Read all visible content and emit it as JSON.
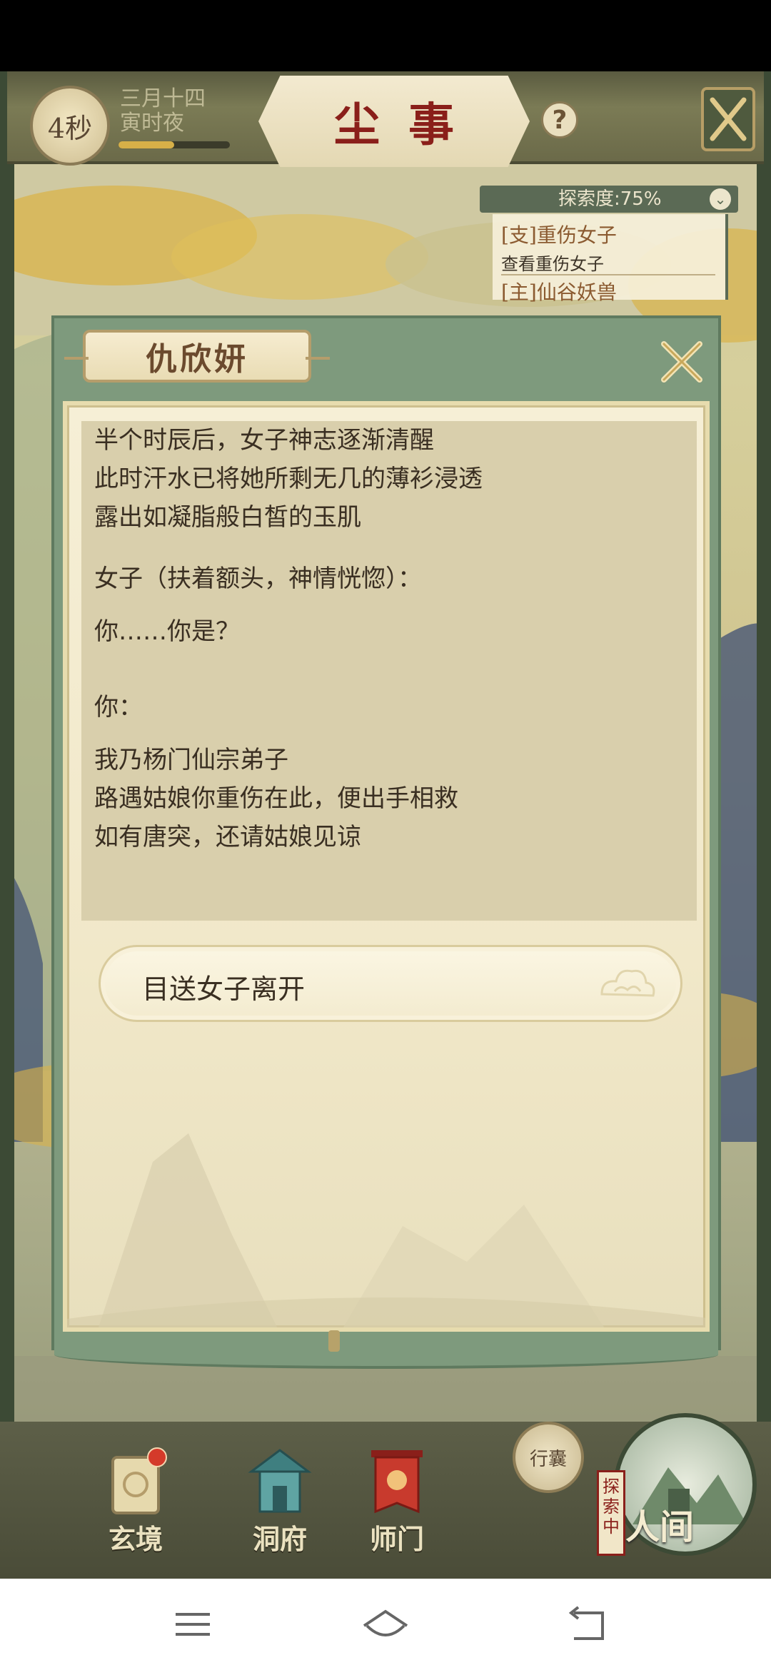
{
  "header": {
    "timer": "4秒",
    "date": "三月十四",
    "time_of_day": "寅时夜",
    "title": "尘事",
    "help": "?",
    "time_progress": 0.5
  },
  "explore": {
    "progress_label": "探索度:75%",
    "quests": [
      {
        "title": "[支]重伤女子",
        "subtitle": "查看重伤女子"
      },
      {
        "title": "[主]仙谷妖兽"
      }
    ]
  },
  "dialog": {
    "speaker_name": "仇欣妍",
    "paragraphs": [
      {
        "lines": [
          "半个时辰后，女子神志逐渐清醒",
          "此时汗水已将她所剩无几的薄衫浸透",
          "露出如凝脂般白皙的玉肌"
        ]
      },
      {
        "lines": [
          "女子（扶着额头，神情恍惚）："
        ]
      },
      {
        "lines": [
          "你……你是？"
        ]
      },
      {
        "lines": [
          "你："
        ]
      },
      {
        "lines": [
          "我乃杨门仙宗弟子",
          "路遇姑娘你重伤在此，便出手相救",
          "如有唐突，还请姑娘见谅"
        ]
      }
    ],
    "choice": "目送女子离开"
  },
  "bottom_nav": {
    "items": [
      {
        "label": "玄境",
        "icon": "scroll-icon"
      },
      {
        "label": "洞府",
        "icon": "pavilion-icon"
      },
      {
        "label": "师门",
        "icon": "banner-icon"
      }
    ],
    "bag_label": "行囊",
    "explore_tag": "探索中",
    "world_label": "人间"
  },
  "android_nav": {
    "menu": "menu-icon",
    "home": "home-icon",
    "back": "back-icon"
  },
  "colors": {
    "title_red": "#8a1f1a",
    "dialog_green": "#7e9a7d",
    "parchment": "#f6efd6",
    "text_dark": "#3a2f22",
    "quest_brown": "#8b5a30"
  }
}
